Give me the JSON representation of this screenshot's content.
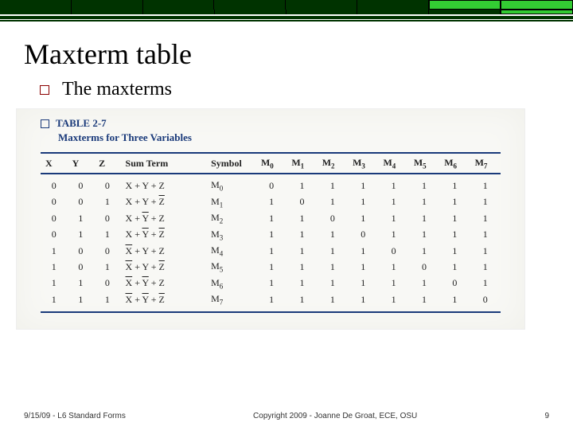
{
  "title": "Maxterm table",
  "bullet": "The maxterms",
  "table": {
    "label": "TABLE 2-7",
    "subtitle": "Maxterms for Three Variables",
    "headers": {
      "x": "X",
      "y": "Y",
      "z": "Z",
      "sum": "Sum Term",
      "symbol": "Symbol",
      "m0": "M",
      "m0s": "0",
      "m1": "M",
      "m1s": "1",
      "m2": "M",
      "m2s": "2",
      "m3": "M",
      "m3s": "3",
      "m4": "M",
      "m4s": "4",
      "m5": "M",
      "m5s": "5",
      "m6": "M",
      "m6s": "6",
      "m7": "M",
      "m7s": "7"
    },
    "rows": [
      {
        "x": "0",
        "y": "0",
        "z": "0",
        "sumA": "X",
        "sumAov": "",
        "sumB": "Y",
        "sumBov": "",
        "sumC": "Z",
        "sumCov": "",
        "sym": "M",
        "syms": "0",
        "m": [
          "0",
          "1",
          "1",
          "1",
          "1",
          "1",
          "1",
          "1"
        ]
      },
      {
        "x": "0",
        "y": "0",
        "z": "1",
        "sumA": "X",
        "sumAov": "",
        "sumB": "Y",
        "sumBov": "",
        "sumC": "Z",
        "sumCov": "ov",
        "sym": "M",
        "syms": "1",
        "m": [
          "1",
          "0",
          "1",
          "1",
          "1",
          "1",
          "1",
          "1"
        ]
      },
      {
        "x": "0",
        "y": "1",
        "z": "0",
        "sumA": "X",
        "sumAov": "",
        "sumB": "Y",
        "sumBov": "ov",
        "sumC": "Z",
        "sumCov": "",
        "sym": "M",
        "syms": "2",
        "m": [
          "1",
          "1",
          "0",
          "1",
          "1",
          "1",
          "1",
          "1"
        ]
      },
      {
        "x": "0",
        "y": "1",
        "z": "1",
        "sumA": "X",
        "sumAov": "",
        "sumB": "Y",
        "sumBov": "ov",
        "sumC": "Z",
        "sumCov": "ov",
        "sym": "M",
        "syms": "3",
        "m": [
          "1",
          "1",
          "1",
          "0",
          "1",
          "1",
          "1",
          "1"
        ]
      },
      {
        "x": "1",
        "y": "0",
        "z": "0",
        "sumA": "X",
        "sumAov": "ov",
        "sumB": "Y",
        "sumBov": "",
        "sumC": "Z",
        "sumCov": "",
        "sym": "M",
        "syms": "4",
        "m": [
          "1",
          "1",
          "1",
          "1",
          "0",
          "1",
          "1",
          "1"
        ]
      },
      {
        "x": "1",
        "y": "0",
        "z": "1",
        "sumA": "X",
        "sumAov": "ov",
        "sumB": "Y",
        "sumBov": "",
        "sumC": "Z",
        "sumCov": "ov",
        "sym": "M",
        "syms": "5",
        "m": [
          "1",
          "1",
          "1",
          "1",
          "1",
          "0",
          "1",
          "1"
        ]
      },
      {
        "x": "1",
        "y": "1",
        "z": "0",
        "sumA": "X",
        "sumAov": "ov",
        "sumB": "Y",
        "sumBov": "ov",
        "sumC": "Z",
        "sumCov": "",
        "sym": "M",
        "syms": "6",
        "m": [
          "1",
          "1",
          "1",
          "1",
          "1",
          "1",
          "0",
          "1"
        ]
      },
      {
        "x": "1",
        "y": "1",
        "z": "1",
        "sumA": "X",
        "sumAov": "ov",
        "sumB": "Y",
        "sumBov": "ov",
        "sumC": "Z",
        "sumCov": "ov",
        "sym": "M",
        "syms": "7",
        "m": [
          "1",
          "1",
          "1",
          "1",
          "1",
          "1",
          "1",
          "0"
        ]
      }
    ]
  },
  "footer": {
    "left": "9/15/09 - L6 Standard Forms",
    "center": "Copyright 2009 - Joanne De Groat, ECE, OSU",
    "right": "9"
  }
}
